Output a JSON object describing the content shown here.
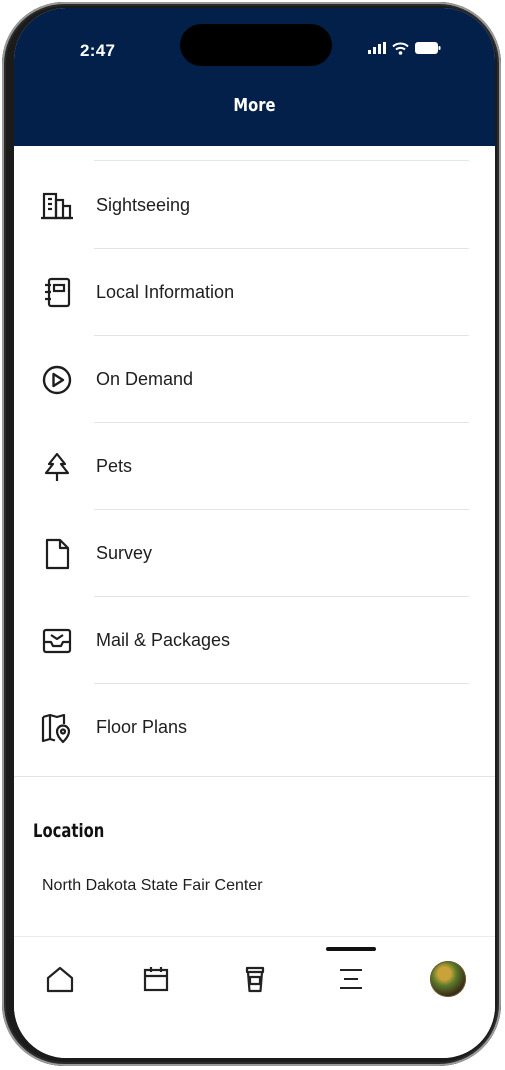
{
  "status_bar": {
    "time": "2:47"
  },
  "header": {
    "title": "More"
  },
  "menu": {
    "items": [
      {
        "label": "Sightseeing",
        "icon": "buildings-icon"
      },
      {
        "label": "Local Information",
        "icon": "notebook-icon"
      },
      {
        "label": "On Demand",
        "icon": "play-circle-icon"
      },
      {
        "label": "Pets",
        "icon": "tree-icon"
      },
      {
        "label": "Survey",
        "icon": "document-icon"
      },
      {
        "label": "Mail & Packages",
        "icon": "mailbox-icon"
      },
      {
        "label": "Floor Plans",
        "icon": "map-pin-icon"
      }
    ]
  },
  "location": {
    "title": "Location",
    "value": "North Dakota State Fair Center"
  },
  "tabbar": {
    "tabs": [
      {
        "icon": "home-icon"
      },
      {
        "icon": "calendar-icon"
      },
      {
        "icon": "coffee-cup-icon"
      },
      {
        "icon": "menu-icon",
        "active": true
      },
      {
        "icon": "avatar"
      }
    ]
  },
  "colors": {
    "header_bg": "#03204a",
    "text": "#1e1e1e",
    "divider": "#e4e4e4"
  }
}
